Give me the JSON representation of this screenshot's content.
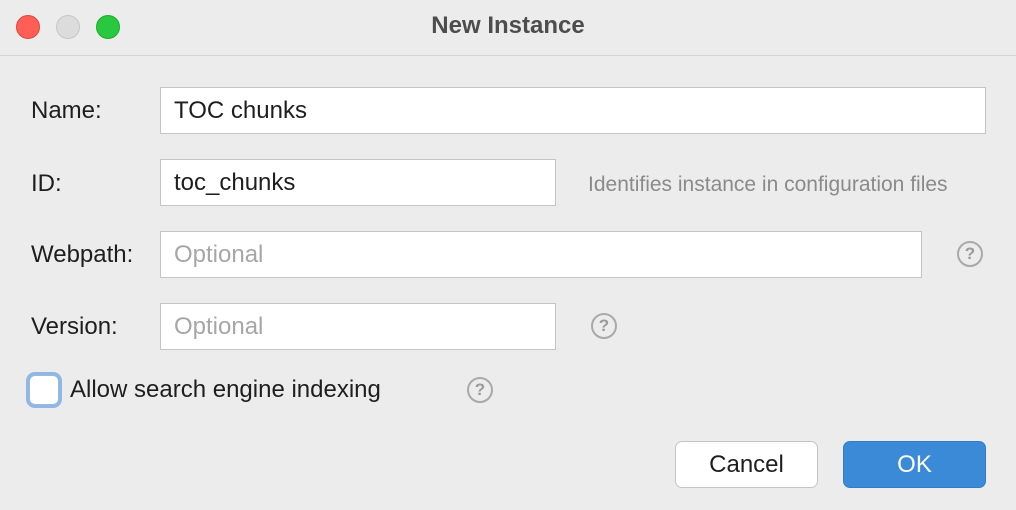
{
  "window": {
    "title": "New Instance"
  },
  "form": {
    "name": {
      "label": "Name:",
      "value": "TOC chunks"
    },
    "id": {
      "label": "ID:",
      "value": "toc_chunks",
      "hint": "Identifies instance in configuration files"
    },
    "webpath": {
      "label": "Webpath:",
      "value": "",
      "placeholder": "Optional"
    },
    "version": {
      "label": "Version:",
      "value": "",
      "placeholder": "Optional"
    },
    "indexing": {
      "label": "Allow search engine indexing",
      "checked": false
    },
    "help_glyph": "?"
  },
  "buttons": {
    "cancel": "Cancel",
    "ok": "OK"
  },
  "colors": {
    "accent": "#3a8ad8",
    "close": "#ff5f57",
    "zoom": "#28c840"
  }
}
